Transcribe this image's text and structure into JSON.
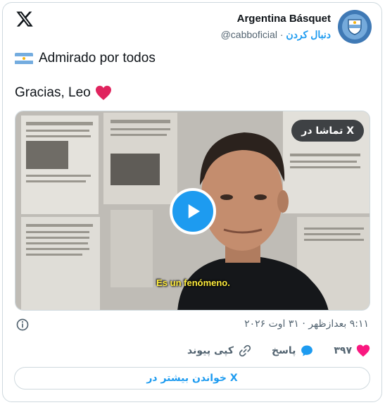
{
  "author": {
    "name": "Argentina Básquet",
    "handle": "@cabboficial",
    "separator": "·",
    "follow_label": "دنبال کردن"
  },
  "post": {
    "line1": "Admirado por todos",
    "line2": "Gracias, Leo",
    "flag_icon": "argentina-flag-icon",
    "heart_icon": "red-heart-icon"
  },
  "media": {
    "watch_label": "تماشا در X",
    "subtitle": "Es un fenómeno.",
    "play_icon": "play-icon"
  },
  "meta": {
    "timestamp": "۹:۱۱ بعدازظهر · ۳۱ اوت ۲۰۲۶"
  },
  "actions": {
    "like_count": "۳۹۷",
    "reply_label": "پاسخ",
    "copy_label": "کپی پیوند"
  },
  "read_more_label": "خواندن بیشتر در X",
  "colors": {
    "accent": "#1d9bf0",
    "like": "#f91880",
    "muted": "#536471",
    "border": "#cfd9de"
  }
}
